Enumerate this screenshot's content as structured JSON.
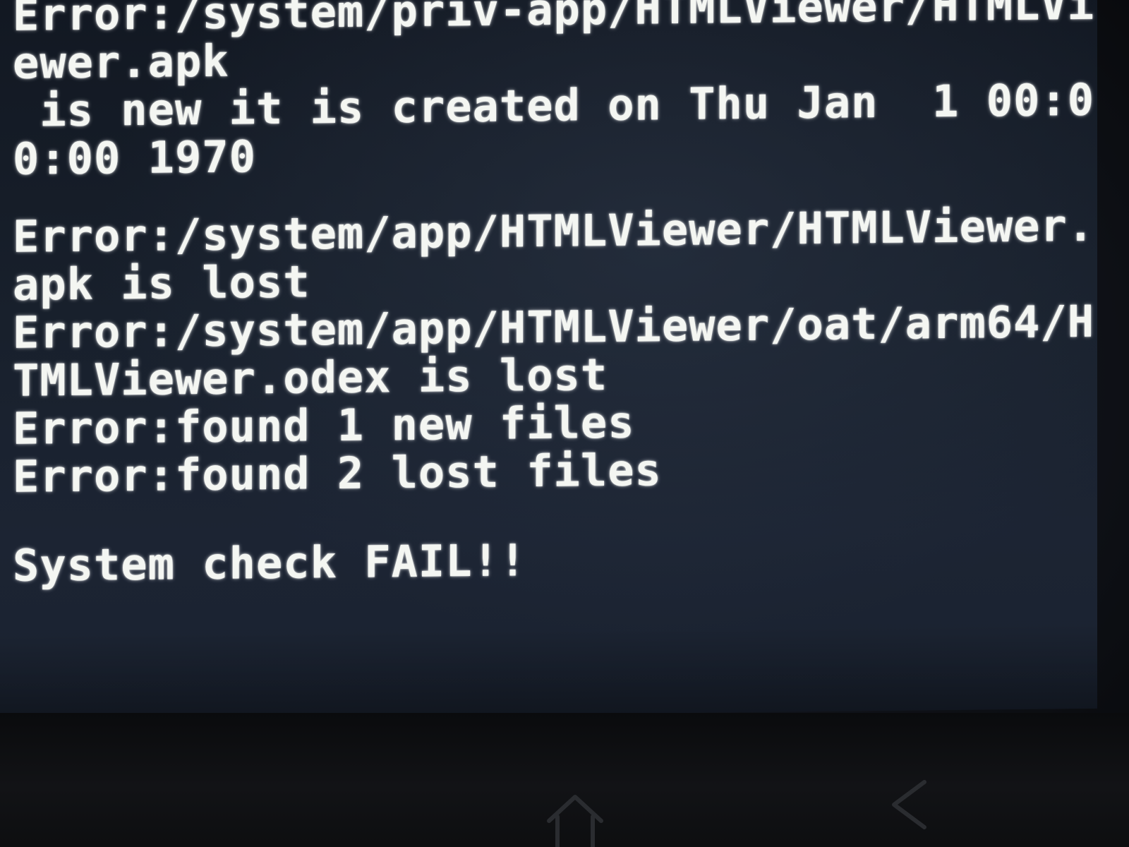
{
  "console": {
    "lines": [
      "Error:/system/priv-app/HTMLViewer/HTMLVi",
      "ewer.apk",
      " is new it is created on Thu Jan  1 00:0",
      "0:00 1970",
      "Error:/system/app/HTMLViewer/HTMLViewer.",
      "apk is lost",
      "Error:/system/app/HTMLViewer/oat/arm64/H",
      "TMLViewer.odex is lost",
      "Error:found 1 new files",
      "Error:found 2 lost files",
      "System check FAIL!!"
    ]
  },
  "nav": {
    "home_icon": "home-icon",
    "back_icon": "back-icon"
  },
  "colors": {
    "text": "#f4f6f2",
    "screen_background": "#18202c",
    "bezel": "#0d0e10"
  }
}
